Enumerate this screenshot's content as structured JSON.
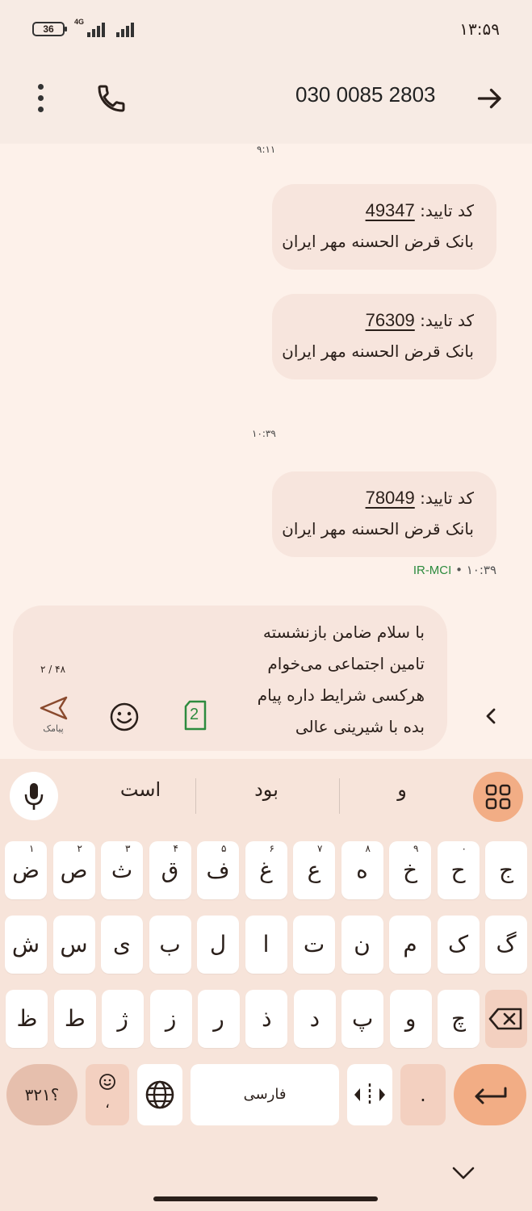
{
  "status_bar": {
    "battery": "36",
    "network": "4G",
    "time": "۱۳:۵۹"
  },
  "header": {
    "contact": "030 0085 2803"
  },
  "messages": {
    "time_sep_1": "۹:۱۱",
    "time_sep_2": "۱۰:۳۹",
    "items": [
      {
        "label": "کد تایید:",
        "code": "49347",
        "text": "بانک قرض الحسنه مهر ایران"
      },
      {
        "label": "کد تایید:",
        "code": "76309",
        "text": "بانک قرض الحسنه مهر ایران"
      },
      {
        "label": "کد تایید:",
        "code": "78049",
        "text": "بانک قرض الحسنه مهر ایران"
      }
    ],
    "last_time": "۱۰:۳۹",
    "carrier": "IR-MCI"
  },
  "compose": {
    "lines": [
      "با سلام ضامن بازنشسته",
      "تامین اجتماعی می‌خوام",
      "هرکسی شرایط داره پیام",
      "بده با شیرینی عالی"
    ],
    "char_count": "۲ / ۴۸",
    "send_label": "پیامک",
    "sim": "2"
  },
  "keyboard": {
    "suggestions": [
      "و",
      "بود",
      "است"
    ],
    "row1": [
      {
        "k": "ج",
        "h": ""
      },
      {
        "k": "ح",
        "h": "۰"
      },
      {
        "k": "خ",
        "h": "۹"
      },
      {
        "k": "ه",
        "h": "۸"
      },
      {
        "k": "ع",
        "h": "۷"
      },
      {
        "k": "غ",
        "h": "۶"
      },
      {
        "k": "ف",
        "h": "۵"
      },
      {
        "k": "ق",
        "h": "۴"
      },
      {
        "k": "ث",
        "h": "۳"
      },
      {
        "k": "ص",
        "h": "۲"
      },
      {
        "k": "ض",
        "h": "۱"
      }
    ],
    "row2": [
      "گ",
      "ک",
      "م",
      "ن",
      "ت",
      "ا",
      "ل",
      "ب",
      "ی",
      "س",
      "ش"
    ],
    "row3": [
      "چ",
      "و",
      "پ",
      "د",
      "ذ",
      "ر",
      "ز",
      "ژ",
      "ط",
      "ظ"
    ],
    "numbers_key": "؟۳۲۱",
    "emoji_key_sub": "،",
    "space_label": "فارسی",
    "dot_key": "."
  }
}
